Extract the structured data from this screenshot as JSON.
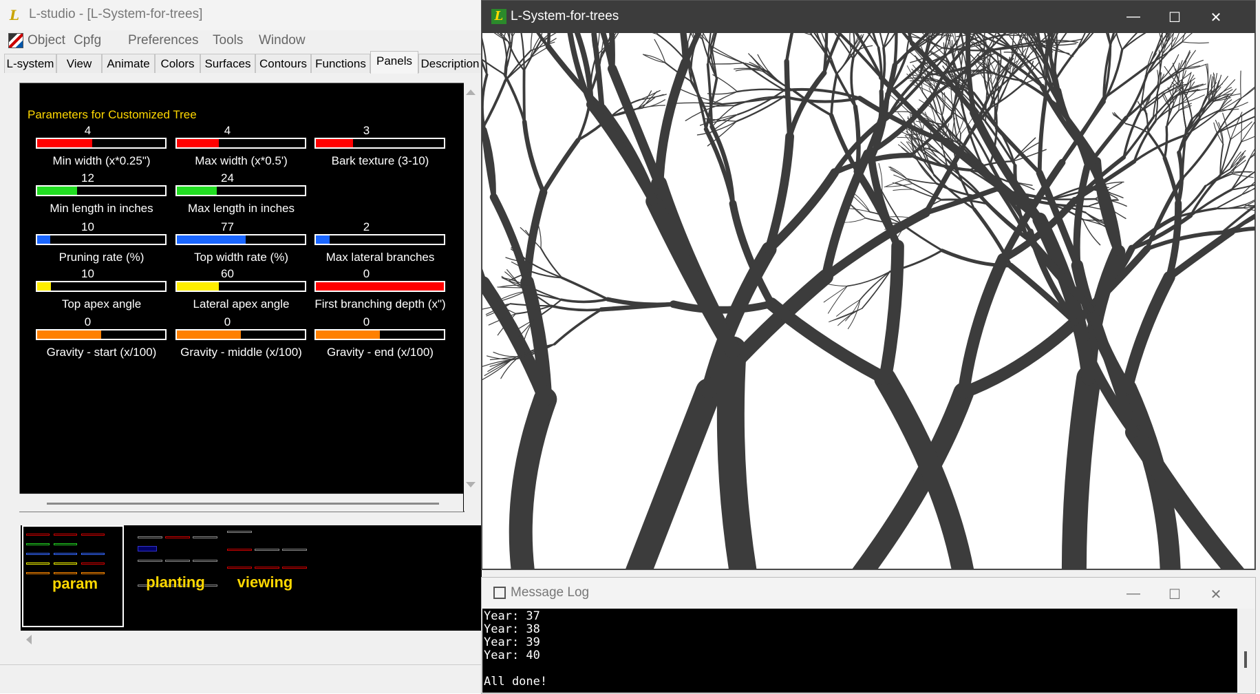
{
  "main_window": {
    "title": "L-studio - [L-System-for-trees]",
    "menu": [
      "Object",
      "Cpfg",
      "Preferences",
      "Tools",
      "Window"
    ],
    "tabs": [
      "L-system",
      "View",
      "Animate",
      "Colors",
      "Surfaces",
      "Contours",
      "Functions",
      "Panels",
      "Description"
    ],
    "active_tab": "Panels"
  },
  "panel": {
    "title": "Parameters for Customized Tree",
    "sliders": [
      {
        "value": "4",
        "label": "Min width (x*0.25\")",
        "fill_fraction": 0.43,
        "color": "#ff0000"
      },
      {
        "value": "4",
        "label": "Max width (x*0.5')",
        "fill_fraction": 0.33,
        "color": "#ff0000"
      },
      {
        "value": "3",
        "label": "Bark texture (3-10)",
        "fill_fraction": 0.29,
        "color": "#ff0000"
      },
      {
        "value": "12",
        "label": "Min length in inches",
        "fill_fraction": 0.31,
        "color": "#22dd22"
      },
      {
        "value": "24",
        "label": "Max length in inches",
        "fill_fraction": 0.31,
        "color": "#22dd22"
      },
      {
        "value": "10",
        "label": "Pruning rate (%)",
        "fill_fraction": 0.1,
        "color": "#1a66ff"
      },
      {
        "value": "77",
        "label": "Top width rate (%)",
        "fill_fraction": 0.54,
        "color": "#1a66ff"
      },
      {
        "value": "2",
        "label": "Max lateral branches",
        "fill_fraction": 0.11,
        "color": "#1a66ff"
      },
      {
        "value": "10",
        "label": "Top apex angle",
        "fill_fraction": 0.11,
        "color": "#ffee00"
      },
      {
        "value": "60",
        "label": "Lateral apex angle",
        "fill_fraction": 0.33,
        "color": "#ffee00"
      },
      {
        "value": "0",
        "label": "First branching depth (x\")",
        "fill_fraction": 1.0,
        "color": "#ff0000"
      },
      {
        "value": "0",
        "label": "Gravity - start (x/100)",
        "fill_fraction": 0.5,
        "color": "#ff8000"
      },
      {
        "value": "0",
        "label": "Gravity - middle (x/100)",
        "fill_fraction": 0.5,
        "color": "#ff8000"
      },
      {
        "value": "0",
        "label": "Gravity - end (x/100)",
        "fill_fraction": 0.5,
        "color": "#ff8000"
      }
    ]
  },
  "panel_thumbnails": [
    {
      "name": "param",
      "selected": true
    },
    {
      "name": "planting",
      "selected": false
    },
    {
      "name": "viewing",
      "selected": false
    }
  ],
  "render_window": {
    "title": "L-System-for-trees",
    "branch_color": "#3c3c3c",
    "background": "#ffffff"
  },
  "message_log": {
    "title": "Message Log",
    "lines": [
      "Year: 37",
      "Year: 38",
      "Year: 39",
      "Year: 40",
      "",
      "All done!"
    ]
  },
  "window_controls": {
    "minimize": "—",
    "maximize": "☐",
    "close": "✕"
  }
}
